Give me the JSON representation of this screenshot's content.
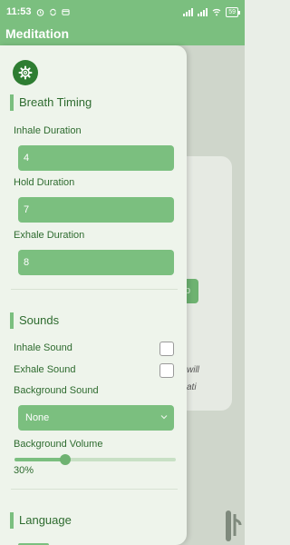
{
  "status_bar": {
    "time": "11:53",
    "battery": "59"
  },
  "app": {
    "title": "Meditation"
  },
  "background": {
    "button_text": "p",
    "line1": "will",
    "line2": "ati"
  },
  "drawer": {
    "breath_timing": {
      "title": "Breath Timing",
      "inhale_label": "Inhale Duration",
      "inhale_value": "4",
      "hold_label": "Hold Duration",
      "hold_value": "7",
      "exhale_label": "Exhale Duration",
      "exhale_value": "8"
    },
    "sounds": {
      "title": "Sounds",
      "inhale_sound_label": "Inhale Sound",
      "inhale_sound_checked": false,
      "exhale_sound_label": "Exhale Sound",
      "exhale_sound_checked": false,
      "background_sound_label": "Background Sound",
      "background_sound_value": "None",
      "background_volume_label": "Background Volume",
      "background_volume_value": "30%",
      "background_volume_fraction": 0.3
    },
    "language": {
      "title": "Language"
    }
  },
  "colors": {
    "accent": "#7bbf7f",
    "accent_dark": "#2e7d32",
    "drawer_bg": "#eef4eb",
    "text": "#2e6b2f"
  },
  "icons": {
    "settings": "gear-icon",
    "dropdown": "chevron-down-icon",
    "status_clock": "alarm-icon",
    "status_sync": "sync-icon",
    "status_payment": "payment-icon"
  }
}
